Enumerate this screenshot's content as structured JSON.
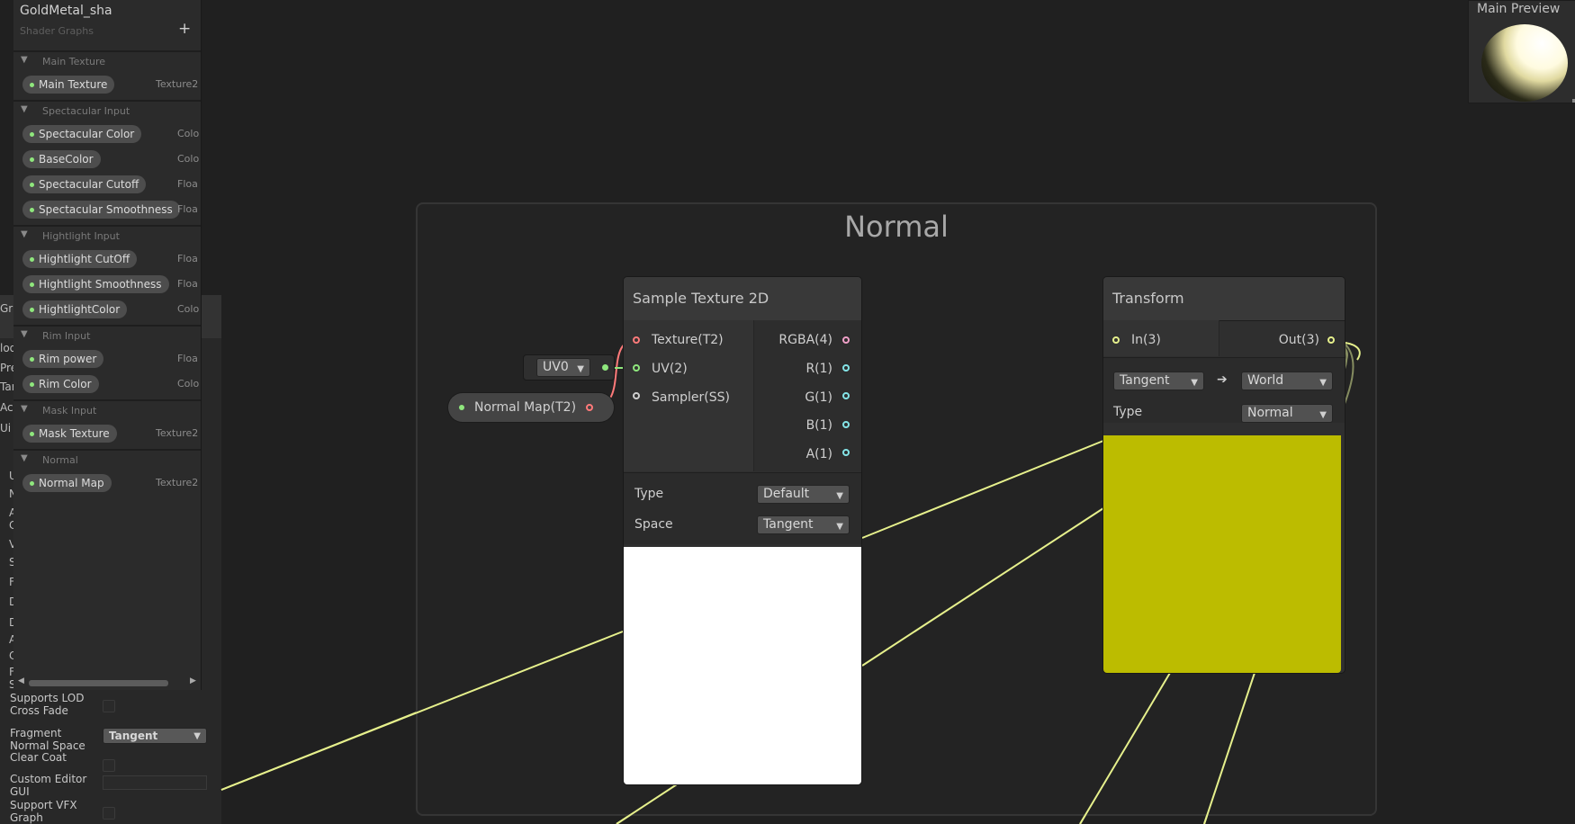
{
  "blackboard": {
    "title": "GoldMetal_sha",
    "subtitle": "Shader Graphs",
    "add_label": "+",
    "sections": [
      {
        "name": "Main Texture",
        "props": [
          {
            "label": "Main Texture",
            "type": "Texture2"
          }
        ]
      },
      {
        "name": "Spectacular Input",
        "props": [
          {
            "label": "Spectacular Color",
            "type": "Colo"
          },
          {
            "label": "BaseColor",
            "type": "Colo"
          },
          {
            "label": "Spectacular Cutoff",
            "type": "Floa"
          },
          {
            "label": "Spectacular Smoothness",
            "type": "Floa"
          }
        ]
      },
      {
        "name": "Hightlight Input",
        "props": [
          {
            "label": "Hightlight CutOff",
            "type": "Floa"
          },
          {
            "label": "Hightlight Smoothness",
            "type": "Floa"
          },
          {
            "label": "HightlightColor",
            "type": "Colo"
          }
        ]
      },
      {
        "name": "Rim Input",
        "props": [
          {
            "label": "Rim power",
            "type": "Floa"
          },
          {
            "label": "Rim Color",
            "type": "Colo"
          }
        ]
      },
      {
        "name": "Mask Input",
        "props": [
          {
            "label": "Mask Texture",
            "type": "Texture2"
          }
        ]
      },
      {
        "name": "Normal",
        "props": [
          {
            "label": "Normal Map",
            "type": "Texture2"
          }
        ]
      }
    ]
  },
  "inspector": {
    "partial_left": [
      "Gra",
      "lod",
      "Pre",
      "Tar",
      "Ac",
      "Ui",
      "U",
      "N",
      "A",
      "C",
      "V",
      "S",
      "F",
      "D",
      "D",
      "A",
      "C",
      "F",
      "S"
    ],
    "rows": [
      {
        "label": "Supports LOD Cross Fade",
        "kind": "checkbox"
      },
      {
        "label": "Fragment Normal Space",
        "kind": "dropdown",
        "value": "Tangent"
      },
      {
        "label": "Clear Coat",
        "kind": "checkbox"
      },
      {
        "label": "Custom Editor GUI",
        "kind": "text",
        "value": ""
      },
      {
        "label": "Support VFX Graph",
        "kind": "checkbox"
      }
    ]
  },
  "group": {
    "title": "Normal"
  },
  "property_node": {
    "label": "Normal Map(T2)"
  },
  "uv_dropdown": {
    "value": "UV0"
  },
  "sample_node": {
    "title": "Sample Texture 2D",
    "inputs": [
      "Texture(T2)",
      "UV(2)",
      "Sampler(SS)"
    ],
    "outputs": [
      "RGBA(4)",
      "R(1)",
      "G(1)",
      "B(1)",
      "A(1)"
    ],
    "type_label": "Type",
    "type_value": "Default",
    "space_label": "Space",
    "space_value": "Tangent"
  },
  "transform_node": {
    "title": "Transform",
    "input": "In(3)",
    "output": "Out(3)",
    "from": "Tangent",
    "arrow": "➔",
    "to": "World",
    "type_label": "Type",
    "type_value": "Normal"
  },
  "main_preview": {
    "title": "Main Preview"
  },
  "colors": {
    "background": "#202020",
    "wire_yellow": "#e6f08c",
    "wire_pink": "#f0a0c8",
    "preview_yellow": "#bcbc00",
    "texture_port": "#ff7a7a",
    "vector_port": "#8fe77d",
    "float_port": "#84e4e7"
  }
}
